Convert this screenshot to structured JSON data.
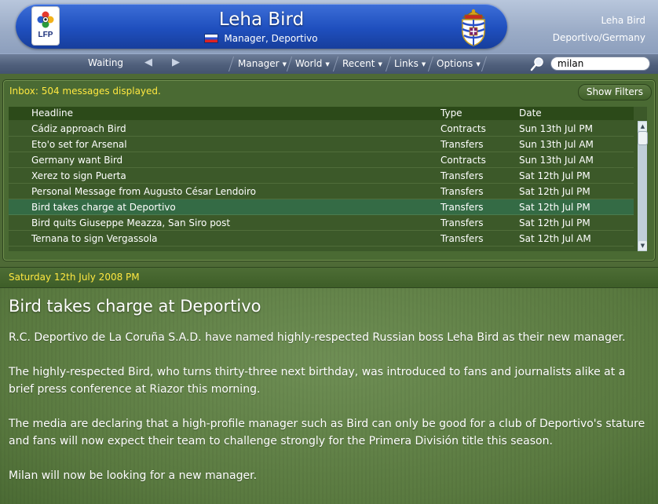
{
  "header": {
    "logo_text": "LFP",
    "manager_name": "Leha Bird",
    "subtitle": "Manager, Deportivo",
    "right_name": "Leha Bird",
    "right_club": "Deportivo/Germany"
  },
  "toolbar": {
    "status": "Waiting",
    "menus": [
      "Manager",
      "World",
      "Recent",
      "Links",
      "Options"
    ],
    "search_value": "milan"
  },
  "inbox": {
    "count_text": "Inbox: 504 messages displayed.",
    "show_filters_label": "Show Filters",
    "columns": [
      "Headline",
      "Type",
      "Date"
    ],
    "rows": [
      {
        "headline": "Cádiz approach Bird",
        "type": "Contracts",
        "date": "Sun 13th Jul PM"
      },
      {
        "headline": "Eto'o set for Arsenal",
        "type": "Transfers",
        "date": "Sun 13th Jul AM"
      },
      {
        "headline": "Germany want Bird",
        "type": "Contracts",
        "date": "Sun 13th Jul AM"
      },
      {
        "headline": "Xerez to sign Puerta",
        "type": "Transfers",
        "date": "Sat 12th Jul PM"
      },
      {
        "headline": "Personal Message from Augusto César Lendoiro",
        "type": "Transfers",
        "date": "Sat 12th Jul PM"
      },
      {
        "headline": "Bird takes charge at Deportivo",
        "type": "Transfers",
        "date": "Sat 12th Jul PM"
      },
      {
        "headline": "Bird quits Giuseppe Meazza, San Siro post",
        "type": "Transfers",
        "date": "Sat 12th Jul PM"
      },
      {
        "headline": "Ternana to sign Vergassola",
        "type": "Transfers",
        "date": "Sat 12th Jul AM"
      }
    ],
    "selected_index": 5
  },
  "message": {
    "date": "Saturday 12th July 2008 PM",
    "title": "Bird takes charge at Deportivo",
    "paragraphs": [
      "R.C. Deportivo de La Coruña S.A.D. have named highly-respected Russian boss Leha Bird as their new manager.",
      "The highly-respected Bird, who turns thirty-three next birthday, was introduced to fans and journalists alike at a brief press conference at Riazor this morning.",
      "The media are declaring that a high-profile manager such as Bird can only be good for a club of Deportivo's stature and fans will now expect their team to challenge strongly for the Primera División title this season.",
      "Milan will now be looking for a new manager."
    ]
  },
  "colors": {
    "accent_yellow": "#ffe840",
    "header_blue": "#1f4fbe",
    "selected_row": "#346b45"
  }
}
